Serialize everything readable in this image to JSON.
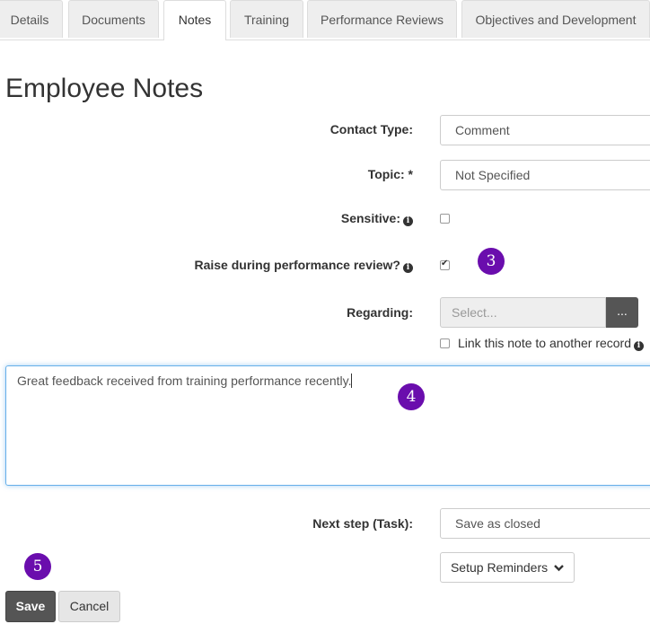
{
  "tabs": [
    {
      "label": "Details",
      "active": false
    },
    {
      "label": "Documents",
      "active": false
    },
    {
      "label": "Notes",
      "active": true
    },
    {
      "label": "Training",
      "active": false
    },
    {
      "label": "Performance Reviews",
      "active": false
    },
    {
      "label": "Objectives and Development",
      "active": false
    }
  ],
  "page_title": "Employee Notes",
  "form": {
    "contact_type": {
      "label": "Contact Type:",
      "value": "Comment"
    },
    "topic": {
      "label": "Topic: *",
      "value": "Not Specified"
    },
    "sensitive": {
      "label": "Sensitive:",
      "checked": false
    },
    "raise_review": {
      "label": "Raise during performance review?",
      "checked": true
    },
    "regarding": {
      "label": "Regarding:",
      "placeholder": "Select...",
      "button_label": "..."
    },
    "link_record": {
      "label": "Link this note to another record",
      "checked": false
    },
    "note_text": "Great feedback received from training performance recently.",
    "next_step": {
      "label": "Next step (Task):",
      "value": "Save as closed"
    },
    "setup_reminders": "Setup Reminders"
  },
  "badges": {
    "b3": "3",
    "b4": "4",
    "b5": "5"
  },
  "actions": {
    "save": "Save",
    "cancel": "Cancel"
  },
  "colors": {
    "badge": "#6a0dad",
    "primary_button": "#555555",
    "focus_border": "#66afe9"
  }
}
